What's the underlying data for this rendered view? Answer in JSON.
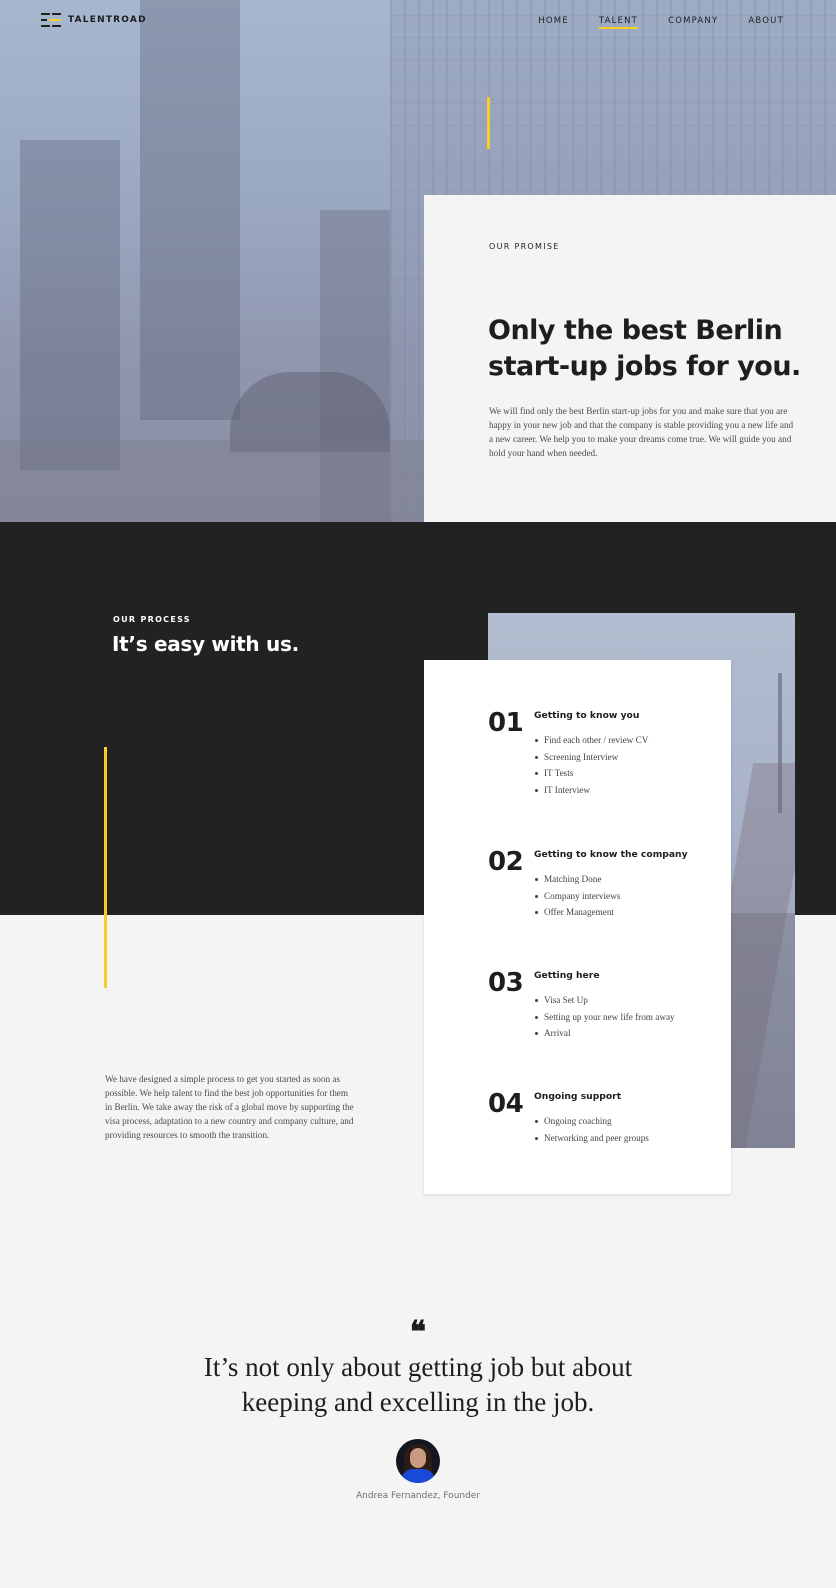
{
  "nav": {
    "logo_text": "TALENTROAD",
    "links": [
      {
        "label": "HOME",
        "active": false
      },
      {
        "label": "TALENT",
        "active": true
      },
      {
        "label": "COMPANY",
        "active": false
      },
      {
        "label": "ABOUT",
        "active": false
      }
    ]
  },
  "promise": {
    "eyebrow": "OUR PROMISE",
    "heading": "Only the best Berlin start-up jobs for you.",
    "body": "We will find only the best Berlin start-up jobs for you and make sure that you are happy in your new job and that the company is stable providing you a new life and a new career. We help you to make your dreams come true. We will guide you and hold your hand when needed."
  },
  "process": {
    "eyebrow": "OUR PROCESS",
    "title": "It’s easy with us.",
    "description": "We have designed a simple process to get you started as soon as possible. We help talent to find the best job opportunities for them in Berlin. We take away the risk of a global move by supporting the visa process, adaptation to a new country and company culture, and providing resources to smooth the transition.",
    "steps": [
      {
        "number": "01",
        "title": "Getting to know you",
        "items": [
          "Find each other / review CV",
          "Screening Interview",
          "IT Tests",
          "IT Interview"
        ]
      },
      {
        "number": "02",
        "title": "Getting to know the company",
        "items": [
          "Matching Done",
          "Company interviews",
          "Offer Management"
        ]
      },
      {
        "number": "03",
        "title": "Getting here",
        "items": [
          "Visa Set Up",
          "Setting up your new life from away",
          "Arrival"
        ]
      },
      {
        "number": "04",
        "title": "Ongoing support",
        "items": [
          "Ongoing coaching",
          "Networking and peer groups"
        ]
      }
    ]
  },
  "quote": {
    "mark": "❝",
    "text": "It’s not only about getting job but about keeping and excelling in the job.",
    "author": "Andrea Fernandez, Founder"
  },
  "colors": {
    "accent": "#f5cf25",
    "dark": "#222222",
    "light_bg": "#f4f4f4"
  }
}
